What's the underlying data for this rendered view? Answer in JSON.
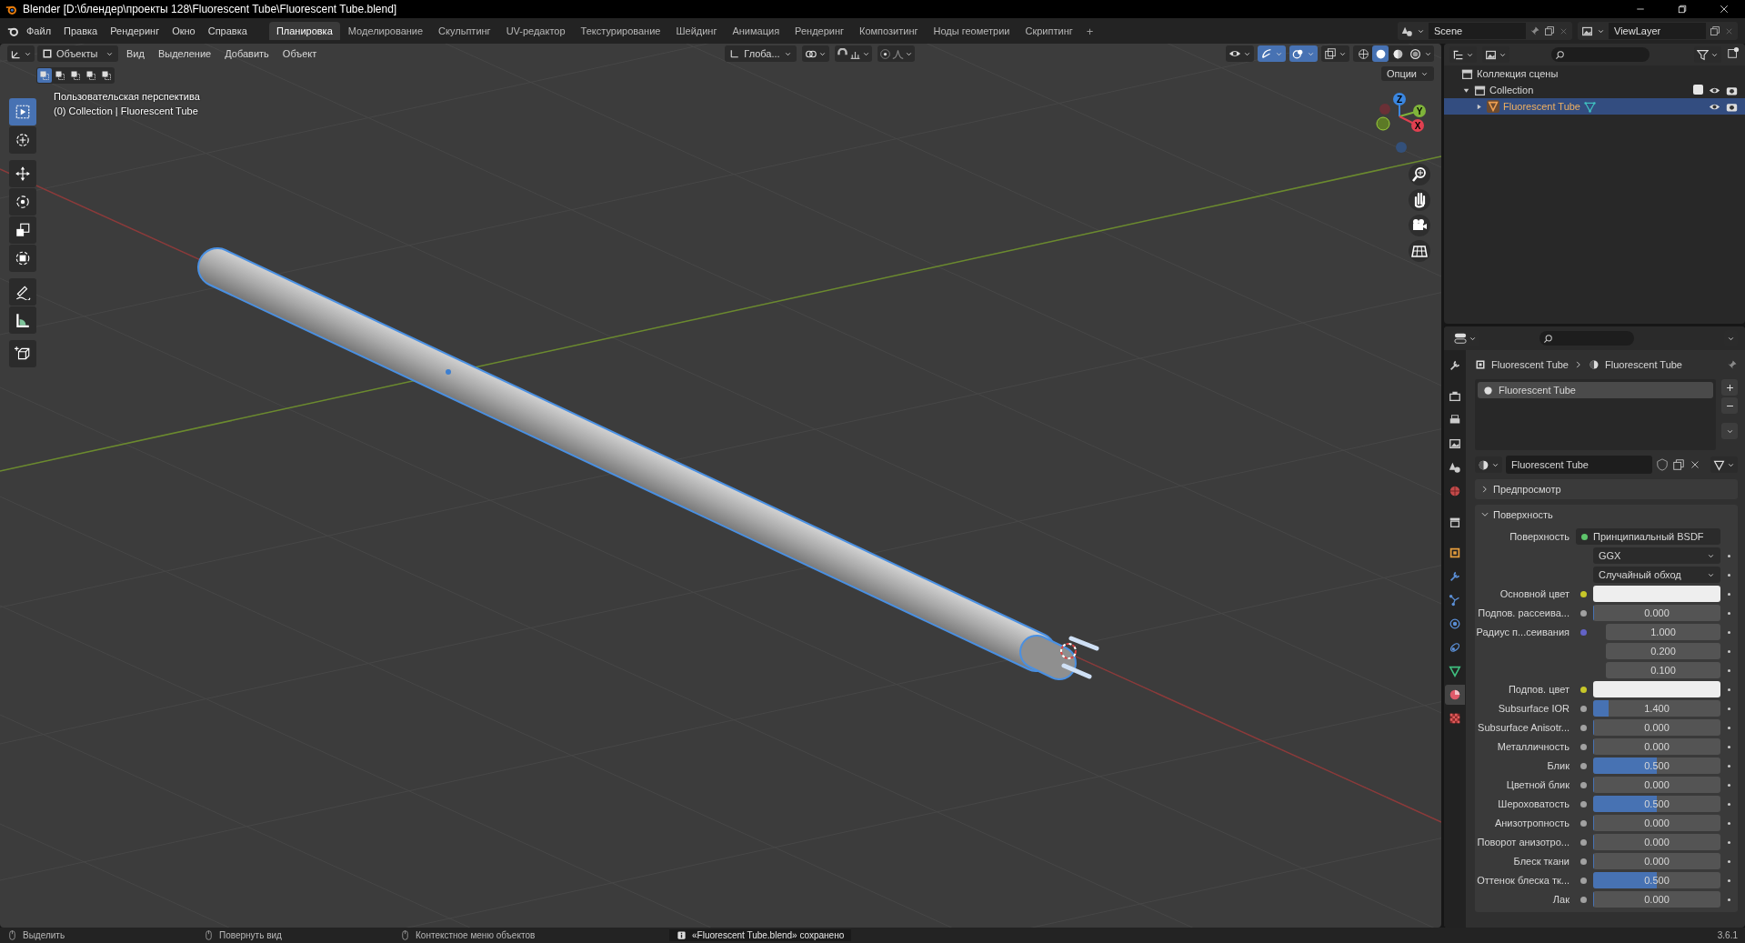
{
  "window": {
    "title": "Blender [D:\\блендер\\проекты 128\\Fluorescent Tube\\Fluorescent Tube.blend]"
  },
  "menu": [
    "Файл",
    "Правка",
    "Рендеринг",
    "Окно",
    "Справка"
  ],
  "workspaces": [
    {
      "label": "Планировка",
      "selected": true
    },
    {
      "label": "Моделирование",
      "selected": false
    },
    {
      "label": "Скульптинг",
      "selected": false
    },
    {
      "label": "UV-редактор",
      "selected": false
    },
    {
      "label": "Текстурирование",
      "selected": false
    },
    {
      "label": "Шейдинг",
      "selected": false
    },
    {
      "label": "Анимация",
      "selected": false
    },
    {
      "label": "Рендеринг",
      "selected": false
    },
    {
      "label": "Композитинг",
      "selected": false
    },
    {
      "label": "Ноды геометрии",
      "selected": false
    },
    {
      "label": "Скриптинг",
      "selected": false
    }
  ],
  "add_workspace": "+",
  "scene": "Scene",
  "view_layer": "ViewLayer",
  "viewport": {
    "mode": "Объекты",
    "menus": [
      "Вид",
      "Выделение",
      "Добавить",
      "Объект"
    ],
    "orientation": "Глоба...",
    "options": "Опции",
    "select_modes": [
      {
        "selected": true
      },
      {
        "selected": false
      },
      {
        "selected": false
      },
      {
        "selected": false
      },
      {
        "selected": false
      }
    ],
    "snapping": {
      "on": false
    },
    "proportional_edit": {
      "on": false
    },
    "toggles": [
      {
        "kind": "visibility",
        "on": false
      },
      {
        "kind": "gizmo",
        "on": true
      },
      {
        "kind": "overlay",
        "on": true
      },
      {
        "kind": "xray",
        "on": false
      }
    ],
    "shading": [
      {
        "kind": "wireframe",
        "selected": false
      },
      {
        "kind": "solid",
        "selected": true
      },
      {
        "kind": "material",
        "selected": false
      },
      {
        "kind": "rendered",
        "selected": false
      }
    ],
    "info": [
      "Пользовательская перспектива",
      "(0) Collection | Fluorescent Tube"
    ],
    "tools": [
      {
        "kind": "select",
        "selected": true
      },
      {
        "kind": "cursor",
        "selected": false
      },
      {
        "kind": "move",
        "selected": false
      },
      {
        "kind": "rotate",
        "selected": false
      },
      {
        "kind": "scale",
        "selected": false
      },
      {
        "kind": "transform",
        "selected": false
      },
      {
        "kind": "annotate",
        "selected": false
      },
      {
        "kind": "measure",
        "selected": false
      },
      {
        "kind": "add_cube",
        "selected": false
      }
    ],
    "gizmo_axes": [
      "Z",
      "Y",
      "X"
    ]
  },
  "outliner": {
    "items": [
      {
        "label": "Коллекция сцены",
        "selected": false,
        "children": [
          {
            "label": "Collection",
            "selected": false,
            "expanded": true,
            "checked": true,
            "children": [
              {
                "label": "Fluorescent Tube",
                "selected": true,
                "expanded": false
              }
            ]
          }
        ]
      }
    ]
  },
  "properties": {
    "tabs": [
      {
        "kind": "tool",
        "selected": false
      },
      {
        "kind": "render",
        "selected": false
      },
      {
        "kind": "output",
        "selected": false
      },
      {
        "kind": "view_layer",
        "selected": false
      },
      {
        "kind": "scene",
        "selected": false
      },
      {
        "kind": "world",
        "selected": false
      },
      {
        "kind": "collection",
        "selected": false
      },
      {
        "kind": "object",
        "selected": false
      },
      {
        "kind": "modifiers",
        "selected": false
      },
      {
        "kind": "particles",
        "selected": false
      },
      {
        "kind": "physics",
        "selected": false
      },
      {
        "kind": "constraints",
        "selected": false
      },
      {
        "kind": "data",
        "selected": false
      },
      {
        "kind": "material",
        "selected": true
      },
      {
        "kind": "texture",
        "selected": false
      }
    ],
    "breadcrumb": [
      "Fluorescent Tube",
      "Fluorescent Tube"
    ],
    "slots": [
      {
        "name": "Fluorescent Tube",
        "selected": true
      }
    ],
    "material": "Fluorescent Tube",
    "panels": [
      {
        "label": "Предпросмотр",
        "expanded": false
      },
      {
        "label": "Поверхность",
        "expanded": true,
        "rows": [
          {
            "kind": "shader",
            "label": "Поверхность",
            "value": "Принципиальный BSDF"
          },
          {
            "kind": "dropdown",
            "value": "GGX"
          },
          {
            "kind": "dropdown",
            "value": "Случайный обход"
          },
          {
            "kind": "color",
            "label": "Основной цвет",
            "color": "#eeeeee"
          },
          {
            "kind": "slider",
            "label": "Подпов. рассеива...",
            "value": "0.000",
            "level": 0
          },
          {
            "kind": "vector",
            "label": "Радиус п...сеивания",
            "values": [
              "1.000",
              "0.200",
              "0.100"
            ]
          },
          {
            "kind": "color",
            "label": "Подпов. цвет",
            "color": "#eeeeee"
          },
          {
            "kind": "slider",
            "label": "Subsurface IOR",
            "value": "1.400",
            "level": 0.12
          },
          {
            "kind": "slider",
            "label": "Subsurface Anisotr...",
            "value": "0.000",
            "level": 0
          },
          {
            "kind": "slider",
            "label": "Металличность",
            "value": "0.000",
            "level": 0
          },
          {
            "kind": "slider",
            "label": "Блик",
            "value": "0.500",
            "level": 0.5
          },
          {
            "kind": "slider",
            "label": "Цветной блик",
            "value": "0.000",
            "level": 0
          },
          {
            "kind": "slider",
            "label": "Шероховатость",
            "value": "0.500",
            "level": 0.5
          },
          {
            "kind": "slider",
            "label": "Анизотропность",
            "value": "0.000",
            "level": 0
          },
          {
            "kind": "slider",
            "label": "Поворот анизотро...",
            "value": "0.000",
            "level": 0
          },
          {
            "kind": "slider",
            "label": "Блеск ткани",
            "value": "0.000",
            "level": 0
          },
          {
            "kind": "slider",
            "label": "Оттенок блеска тк...",
            "value": "0.500",
            "level": 0.5
          },
          {
            "kind": "slider",
            "label": "Лак",
            "value": "0.000",
            "level": 0
          }
        ]
      }
    ]
  },
  "status_bar": {
    "hints": [
      "Выделить",
      "Повернуть вид",
      "Контекстное меню объектов"
    ],
    "message": "«Fluorescent Tube.blend» сохранено",
    "version": "3.6.1"
  }
}
